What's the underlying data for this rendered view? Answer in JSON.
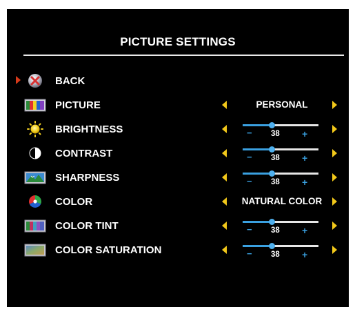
{
  "title": "PICTURE SETTINGS",
  "colors": {
    "accent": "#3aa0e0",
    "arrow": "#f2c81a",
    "selected": "#d63a1a"
  },
  "rows": [
    {
      "label": "BACK",
      "icon": "back-icon",
      "selected": true
    },
    {
      "label": "PICTURE",
      "icon": "picture-icon",
      "value": "PERSONAL"
    },
    {
      "label": "BRIGHTNESS",
      "icon": "brightness-icon",
      "slider": {
        "value": 38,
        "minus": "−",
        "plus": "+"
      }
    },
    {
      "label": "CONTRAST",
      "icon": "contrast-icon",
      "slider": {
        "value": 38,
        "minus": "−",
        "plus": "+"
      }
    },
    {
      "label": "SHARPNESS",
      "icon": "sharpness-icon",
      "slider": {
        "value": 38,
        "minus": "−",
        "plus": "+"
      }
    },
    {
      "label": "COLOR",
      "icon": "color-icon",
      "value": "NATURAL COLOR"
    },
    {
      "label": "COLOR TINT",
      "icon": "color-tint-icon",
      "slider": {
        "value": 38,
        "minus": "−",
        "plus": "+"
      }
    },
    {
      "label": "COLOR SATURATION",
      "icon": "color-saturation-icon",
      "slider": {
        "value": 38,
        "minus": "−",
        "plus": "+"
      }
    }
  ]
}
